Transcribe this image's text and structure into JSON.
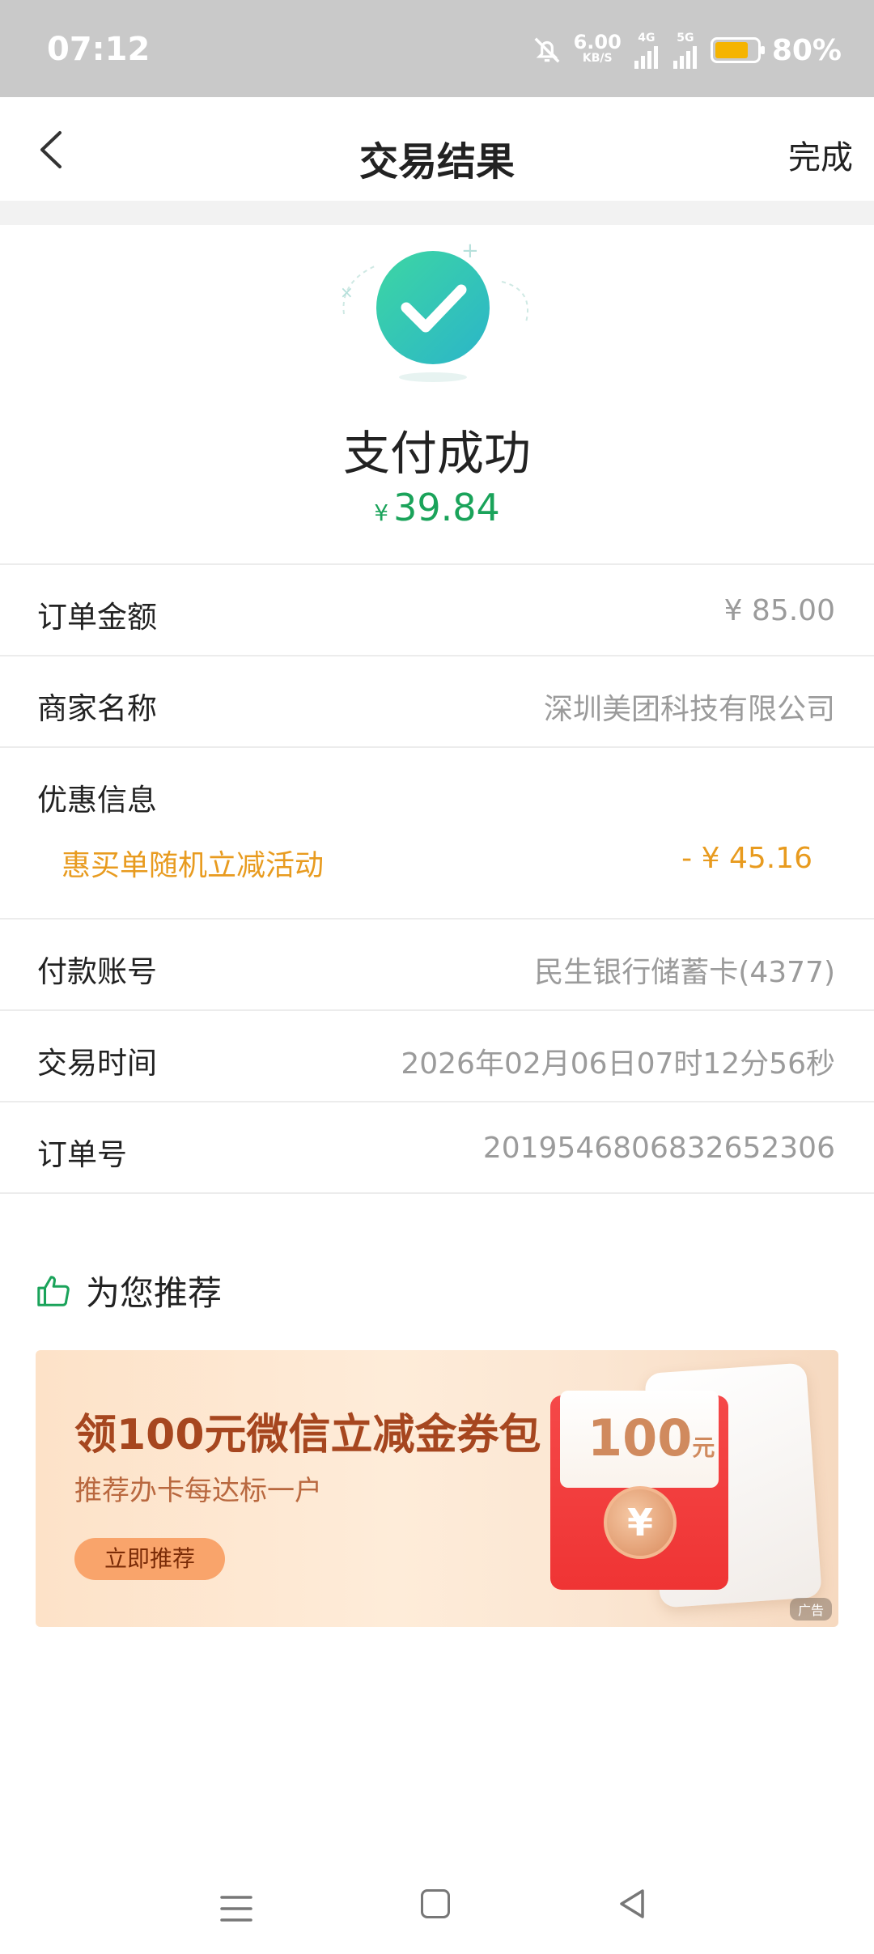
{
  "status_bar": {
    "time": "07:12",
    "net_speed": "6.00",
    "net_unit": "KB/S",
    "signal_1": "4G",
    "signal_2": "5G",
    "battery_percent": "80%",
    "battery_level": 0.8
  },
  "header": {
    "title": "交易结果",
    "done_label": "完成"
  },
  "result": {
    "title": "支付成功",
    "currency_symbol": "¥",
    "amount": "39.84",
    "accent_color": "#1aa35a"
  },
  "details": {
    "order_amount_label": "订单金额",
    "order_amount_value": "¥ 85.00",
    "merchant_label": "商家名称",
    "merchant_value": "深圳美团科技有限公司",
    "discount_label": "优惠信息",
    "discount_name": "惠买单随机立减活动",
    "discount_value": "- ¥ 45.16",
    "account_label": "付款账号",
    "account_value": "民生银行储蓄卡(4377)",
    "time_label": "交易时间",
    "time_value": "2026年02月06日07时12分56秒",
    "order_no_label": "订单号",
    "order_no_value": "2019546806832652306"
  },
  "recommend": {
    "title": "为您推荐",
    "ad": {
      "title": "领100元微信立减金券包",
      "subtitle": "推荐办卡每达标一户",
      "button": "立即推荐",
      "amount": "100",
      "amount_unit": "元",
      "coin_symbol": "¥",
      "tag": "广告"
    }
  }
}
